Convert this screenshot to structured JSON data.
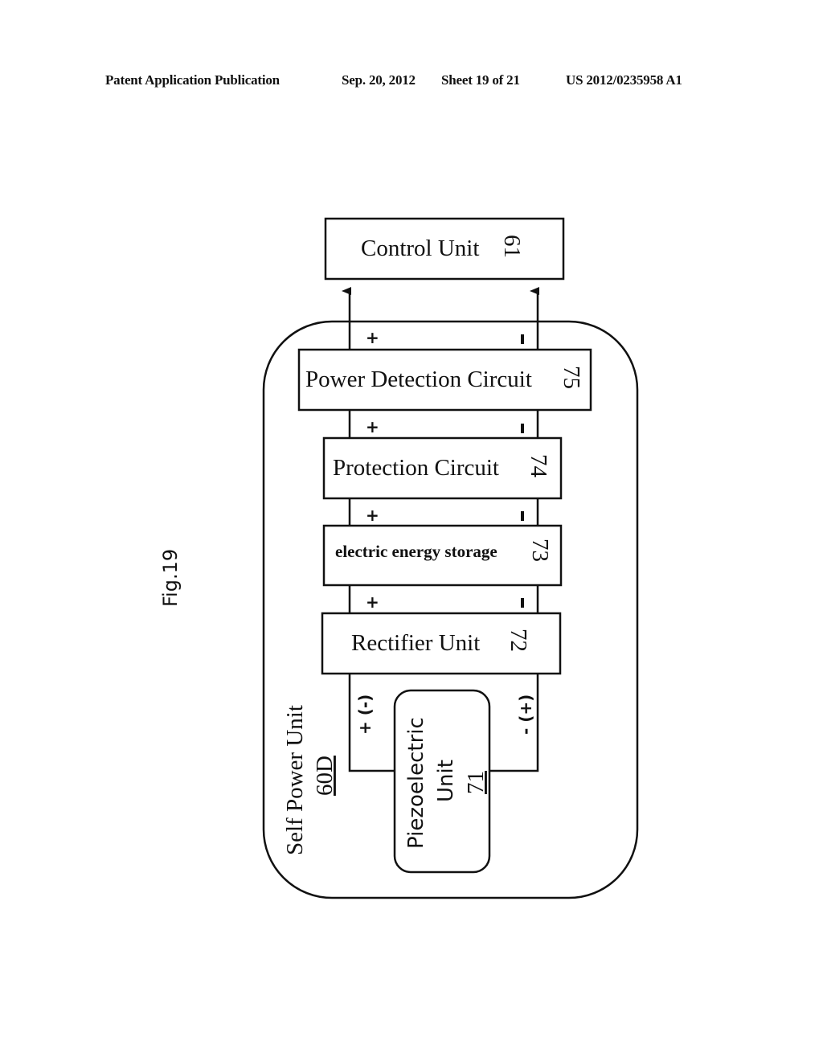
{
  "header": {
    "publication": "Patent Application Publication",
    "date": "Sep. 20, 2012",
    "sheet": "Sheet 19 of 21",
    "number": "US 2012/0235958 A1"
  },
  "figure": {
    "label": "Fig.19",
    "blocks": {
      "control_unit": {
        "name": "Control Unit",
        "ref": "61"
      },
      "power_detection": {
        "name": "Power Detection Circuit",
        "ref": "75"
      },
      "protection": {
        "name": "Protection Circuit",
        "ref": "74"
      },
      "storage": {
        "name": "electric energy storage",
        "ref": "73"
      },
      "rectifier": {
        "name": "Rectifier Unit",
        "ref": "72"
      },
      "piezo": {
        "line1": "Piezoelectric",
        "line2": "Unit",
        "ref": "71"
      }
    },
    "container": {
      "name": "Self Power Unit",
      "ref": "60D"
    },
    "polarity": {
      "plus": "+",
      "minus": "-",
      "piezo_left": "+ (-)",
      "piezo_right": "- (+)"
    }
  }
}
